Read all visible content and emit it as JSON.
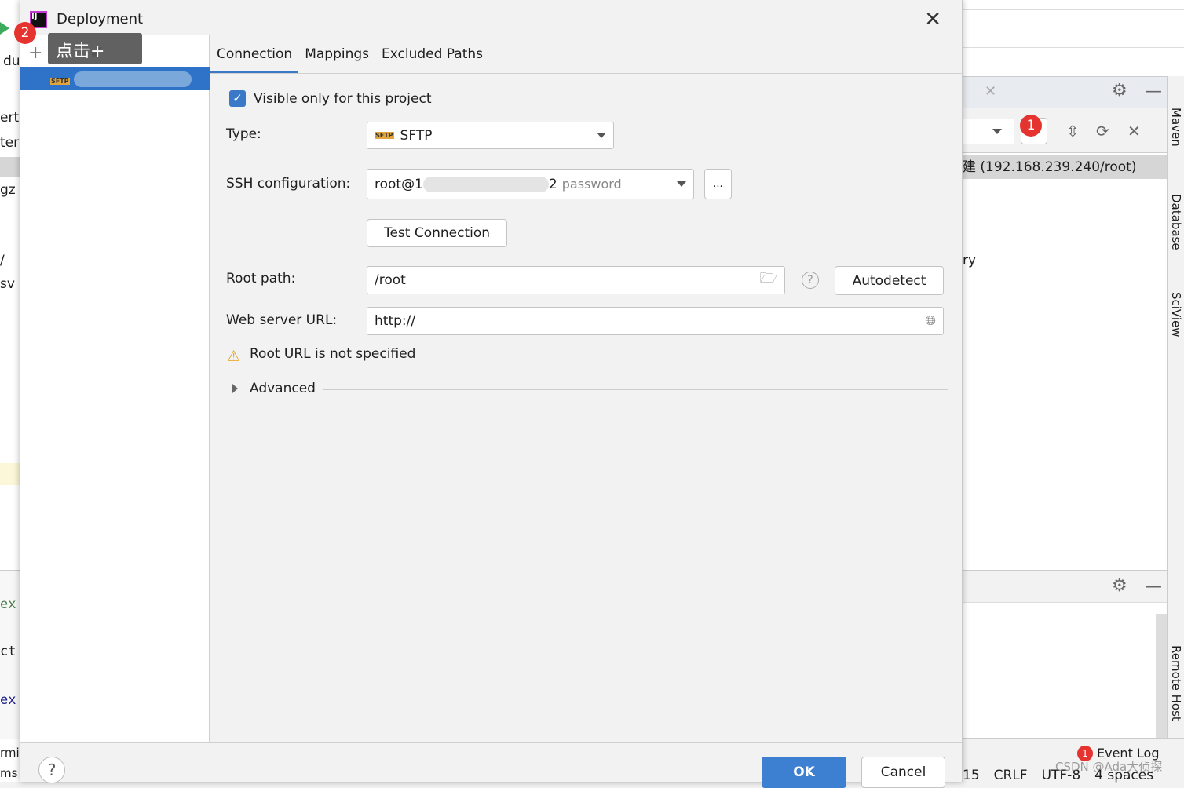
{
  "background": {
    "left_fragments": [
      "du",
      "ert",
      "ter",
      "gz",
      "/",
      "sv",
      "ex",
      "ct",
      "ex",
      "rmi",
      "ms"
    ],
    "remote_host_entry": "建 (192.168.239.240/root)",
    "fragment_ry": "ry",
    "side_tabs": [
      "Maven",
      "Database",
      "SciView",
      "Remote Host"
    ],
    "event_log": "Event Log",
    "event_log_count": "1",
    "status": [
      "15",
      "CRLF",
      "UTF-8",
      "4 spaces"
    ],
    "watermark": "CSDN @Ada大侦探",
    "annotation_1": "1"
  },
  "dialog": {
    "title": "Deployment",
    "annotation_2": "2",
    "tooltip": "点击+",
    "toolbar": {
      "add": "+",
      "remove": "−",
      "check": "✔"
    },
    "tabs": [
      "Connection",
      "Mappings",
      "Excluded Paths"
    ],
    "visible_only": "Visible only for this project",
    "visible_checked": true,
    "type_label": "Type:",
    "type_value": "SFTP",
    "sftp_icon": "SFTP",
    "ssh_label": "SSH configuration:",
    "ssh_value": "root@1",
    "ssh_suffix": "2",
    "ssh_auth": "password",
    "ssh_more": "...",
    "test_connection": "Test Connection",
    "root_label": "Root path:",
    "root_value": "/root",
    "help": "?",
    "autodetect": "Autodetect",
    "url_label": "Web server URL:",
    "url_value": "http://",
    "warning": "Root URL is not specified",
    "advanced": "Advanced",
    "ok": "OK",
    "cancel": "Cancel"
  },
  "colors": {
    "accent": "#3a78c8",
    "ok": "#3d7fd1",
    "badge": "#e5332f",
    "warning": "#e8a317"
  }
}
